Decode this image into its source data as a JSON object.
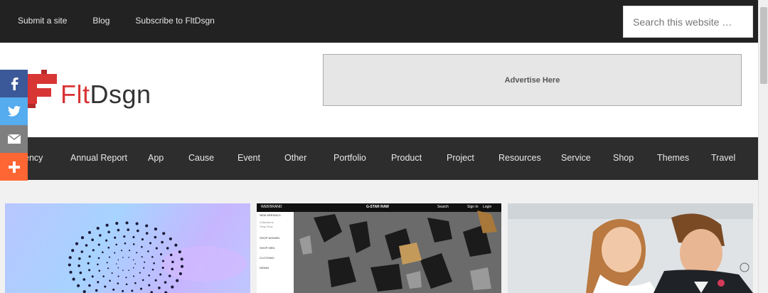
{
  "topnav": {
    "items": [
      "Submit a site",
      "Blog",
      "Subscribe to FltDsgn"
    ]
  },
  "search": {
    "placeholder": "Search this website …"
  },
  "logo": {
    "text_red": "Flt",
    "text_dark": "Dsgn"
  },
  "ad": {
    "label": "Advertise Here"
  },
  "categories": [
    "ency",
    "Annual Report",
    "App",
    "Cause",
    "Event",
    "Other",
    "Portfolio",
    "Product",
    "Project",
    "Resources",
    "Service",
    "Shop",
    "Themes",
    "Travel"
  ],
  "thumbnails": {
    "t2_menu": [
      "WEB",
      "BRAND",
      "G-STAR RAW",
      "Search",
      "Sign In",
      "Login"
    ],
    "t2_side": [
      "NEW ARRIVALS",
      "Collections",
      "Shop Now",
      "SHOP WOMEN",
      "SHOP MEN",
      "CLOTHING",
      "DENIM"
    ]
  },
  "colors": {
    "topbar": "#222222",
    "catnav": "#2d2d2d",
    "brand_red": "#d83535",
    "facebook": "#3b5998",
    "twitter": "#55acee",
    "email": "#7f7f7f",
    "plus": "#ff6633"
  },
  "share_icons": [
    "facebook-icon",
    "twitter-icon",
    "email-icon",
    "plus-icon"
  ]
}
